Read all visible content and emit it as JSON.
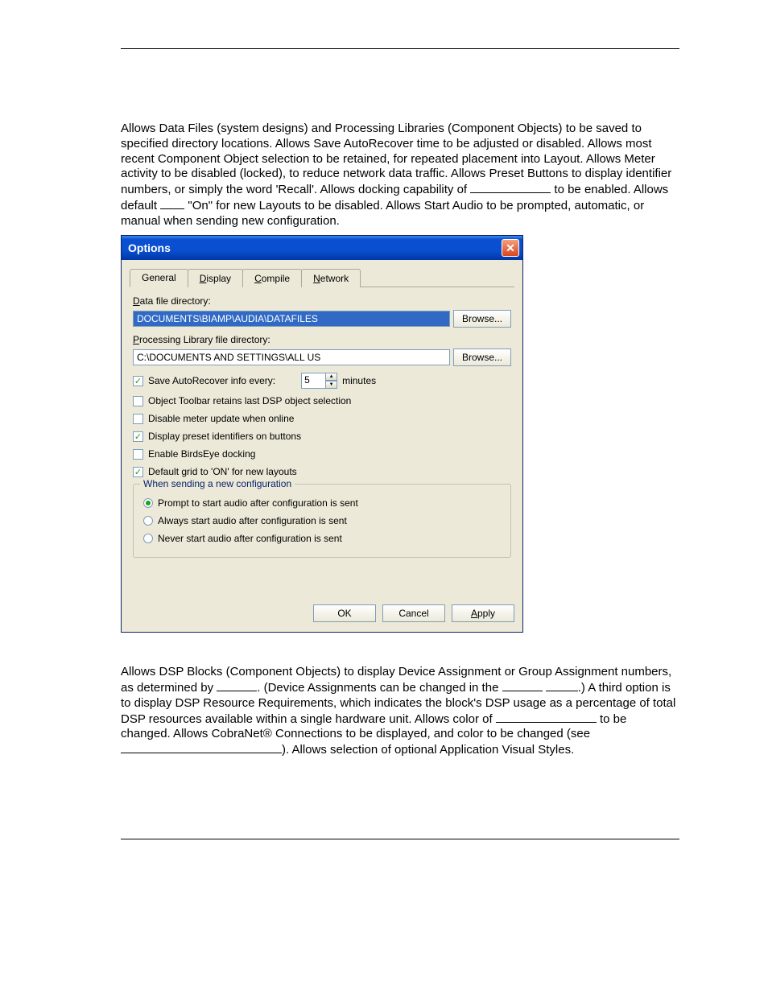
{
  "paragraph1": {
    "t1": "Allows Data Files (system designs) and Processing Libraries (Component Objects) to be saved to specified directory locations. Allows Save AutoRecover time to be adjusted or disabled. Allows most recent Component Object selection to be retained, for repeated placement into Layout. Allows Meter activity to be disabled (locked), to reduce network data traffic. Allows Preset Buttons to display identifier numbers, or simply the word 'Recall'. Allows docking capability of ",
    "t2": " to be enabled. Allows default ",
    "t3": " \"On\" for new Layouts to be disabled. Allows Start Audio to be prompted, automatic, or manual when sending new configuration."
  },
  "dialog": {
    "title": "Options",
    "close": "✕",
    "tabs": [
      {
        "label": "General",
        "active": true
      },
      {
        "label": "Display",
        "underline": "D",
        "rest": "isplay"
      },
      {
        "label": "Compile",
        "underline": "C",
        "rest": "ompile"
      },
      {
        "label": "Network",
        "underline": "N",
        "rest": "etwork"
      }
    ],
    "dataDirLabelU": "D",
    "dataDirLabelRest": "ata file directory:",
    "dataDirValue": "DOCUMENTS\\BIAMP\\AUDIA\\DATAFILES",
    "libDirLabelU": "P",
    "libDirLabelRest": "rocessing Library file directory:",
    "libDirValue": "C:\\DOCUMENTS AND SETTINGS\\ALL US",
    "browse": "Browse...",
    "autorecoverLabel": "Save AutoRecover info every:",
    "autorecoverValue": "5",
    "minutes": "minutes",
    "cbObjectToolbar": "Object Toolbar retains last DSP object selection",
    "cbDisableMeter": "Disable meter update when online",
    "cbPresetIdent": "Display preset identifiers on buttons",
    "cbBirdsEye": "Enable BirdsEye docking",
    "cbDefaultGrid": "Default grid to 'ON' for new layouts",
    "groupTitle": "When sending a new configuration",
    "radioPrompt": "Prompt to start audio after configuration is sent",
    "radioAlways": "Always start audio after configuration is sent",
    "radioNever": "Never start audio after configuration is sent",
    "ok": "OK",
    "cancel": "Cancel",
    "applyU": "A",
    "applyRest": "pply"
  },
  "paragraph2": {
    "t1": "Allows DSP Blocks (Component Objects) to display Device Assignment or Group Assignment numbers, as determined by ",
    "t2": ". (Device Assignments can be changed in the ",
    "t3": ".) A third option is to display DSP Resource Requirements, which indicates the block's DSP usage as a percentage of total DSP resources available within a single hardware unit. Allows color of ",
    "t4": " to be changed. Allows CobraNet® Connections to be displayed, and color to be changed (see ",
    "t5": "). Allows selection of optional Application Visual Styles."
  }
}
